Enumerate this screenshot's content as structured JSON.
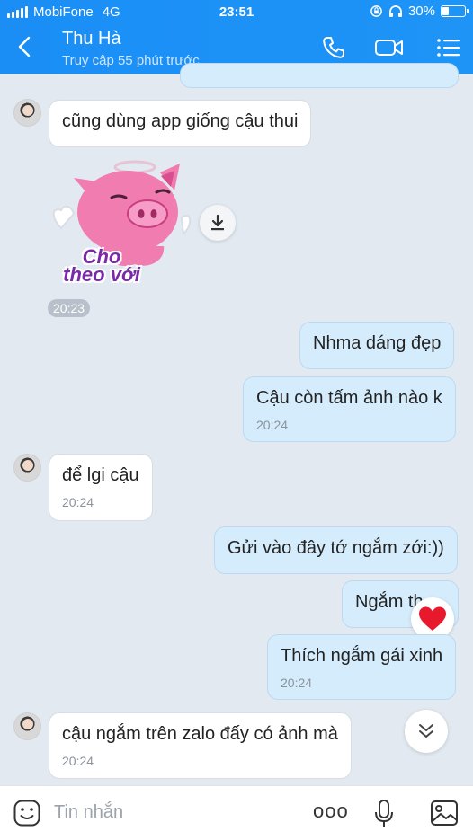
{
  "status": {
    "carrier": "MobiFone",
    "network": "4G",
    "time": "23:51",
    "battery": "30%",
    "battery_level": 0.3
  },
  "header": {
    "name": "Thu Hà",
    "subtitle": "Truy cập 55 phút trước"
  },
  "messages": {
    "m1": {
      "text": "cũng dùng app giống cậu thui"
    },
    "sticker": {
      "text_line1": "Cho",
      "text_line2": "theo với",
      "time": "20:23"
    },
    "m2": {
      "text": "Nhma dáng đẹp"
    },
    "m3": {
      "text": "Cậu còn tấm ảnh nào k",
      "time": "20:24"
    },
    "m4": {
      "text": "để lgi cậu",
      "time": "20:24"
    },
    "m5": {
      "text": "Gửi vào đây tớ ngắm zới:))"
    },
    "m6": {
      "text": "Ngắm th"
    },
    "m7": {
      "text": "Thích ngắm gái xinh",
      "time": "20:24"
    },
    "m8": {
      "text": "cậu ngắm trên zalo đấy có ảnh mà",
      "time": "20:24"
    }
  },
  "composer": {
    "placeholder": "Tin nhắn",
    "more_label": "ooo"
  },
  "colors": {
    "header_blue": "#1e94f7",
    "own_bubble": "#d5ecfd",
    "background": "#e2e9f1",
    "heart": "#e8192c"
  }
}
